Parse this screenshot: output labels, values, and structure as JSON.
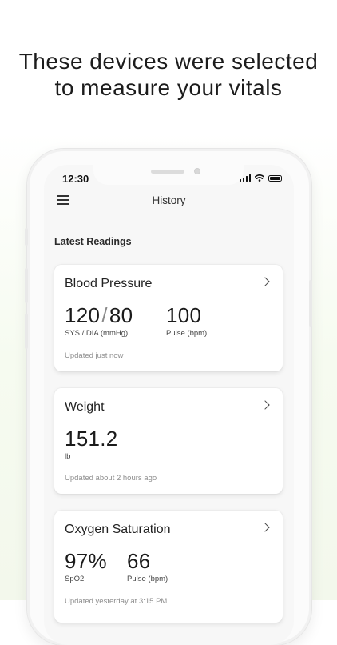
{
  "headline": {
    "line1": "These devices were selected",
    "line2": "to measure your vitals"
  },
  "status_bar": {
    "time": "12:30"
  },
  "app_header": {
    "title": "History",
    "menu_icon": "hamburger-menu-icon"
  },
  "section": {
    "title": "Latest Readings"
  },
  "cards": [
    {
      "title": "Blood Pressure",
      "sys": "120",
      "separator": "/",
      "dia": "80",
      "primary_label": "SYS / DIA (mmHg)",
      "secondary_value": "100",
      "secondary_label": "Pulse (bpm)",
      "updated": "Updated just now"
    },
    {
      "title": "Weight",
      "value": "151.2",
      "label": "lb",
      "updated": "Updated about 2 hours ago"
    },
    {
      "title": "Oxygen Saturation",
      "value": "97%",
      "label": "SpO2",
      "secondary_value": "66",
      "secondary_label": "Pulse (bpm)",
      "updated": "Updated yesterday at 3:15 PM"
    }
  ],
  "colors": {
    "background_tint": "#f3f8ec",
    "card": "#ffffff",
    "muted_text": "#8e8e8e"
  }
}
